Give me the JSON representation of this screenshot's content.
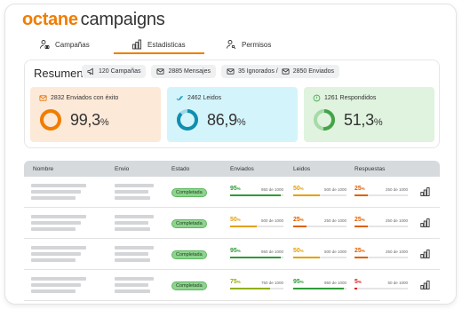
{
  "brand": {
    "part1": "octane",
    "part2": "campaigns"
  },
  "tabs": [
    {
      "label": "Campañas"
    },
    {
      "label": "Estadisticas"
    },
    {
      "label": "Permisos"
    }
  ],
  "summary": {
    "title": "Resumen",
    "chips": [
      {
        "label": "120 Campañas",
        "icon": "megaphone-icon"
      },
      {
        "label": "2885 Mensajes",
        "icon": "envelope-icon"
      },
      {
        "label": "35 Ignorados / ",
        "label2": "2850 Enviados",
        "icon": "envelope-icon"
      }
    ],
    "cards": [
      {
        "label": "2832 Enviados con éxito",
        "value": "99,3",
        "unit": "%",
        "fraction": 0.993,
        "color": "#f07d00",
        "track": "#f8c89a",
        "icon": "envelope-icon"
      },
      {
        "label": "2462 Leidos",
        "value": "86,9",
        "unit": "%",
        "fraction": 0.869,
        "color": "#0e8fb0",
        "track": "#9fd9e8",
        "icon": "double-check-icon"
      },
      {
        "label": "1261 Respondidos",
        "value": "51,3",
        "unit": "%",
        "fraction": 0.513,
        "color": "#44a447",
        "track": "#a8d9a9",
        "icon": "info-circle-icon"
      }
    ]
  },
  "table": {
    "headers": {
      "nombre": "Nombre",
      "envio": "Envio",
      "estado": "Estado",
      "enviados": "Enviados",
      "leidos": "Leidos",
      "respuestas": "Respuestas"
    },
    "rows": [
      {
        "estado": "Completada",
        "enviados": {
          "pct": "95",
          "count": "950 de 1000",
          "fraction": 0.95,
          "color": "#2e9b36"
        },
        "leidos": {
          "pct": "50",
          "count": "500 de 1000",
          "fraction": 0.5,
          "color": "#e3a100"
        },
        "respuestas": {
          "pct": "25",
          "count": "250 de 1000",
          "fraction": 0.25,
          "color": "#e06000"
        }
      },
      {
        "estado": "Completada",
        "enviados": {
          "pct": "50",
          "count": "500 de 1000",
          "fraction": 0.5,
          "color": "#e3a100"
        },
        "leidos": {
          "pct": "25",
          "count": "250 de 1000",
          "fraction": 0.25,
          "color": "#e06000"
        },
        "respuestas": {
          "pct": "25",
          "count": "250 de 1000",
          "fraction": 0.25,
          "color": "#e06000"
        }
      },
      {
        "estado": "Completada",
        "enviados": {
          "pct": "95",
          "count": "950 de 1000",
          "fraction": 0.95,
          "color": "#2e9b36"
        },
        "leidos": {
          "pct": "50",
          "count": "500 de 1000",
          "fraction": 0.5,
          "color": "#e3a100"
        },
        "respuestas": {
          "pct": "25",
          "count": "250 de 1000",
          "fraction": 0.25,
          "color": "#e06000"
        }
      },
      {
        "estado": "Completada",
        "enviados": {
          "pct": "75",
          "count": "750 de 1000",
          "fraction": 0.75,
          "color": "#8fb000"
        },
        "leidos": {
          "pct": "95",
          "count": "950 de 1000",
          "fraction": 0.95,
          "color": "#2e9b36"
        },
        "respuestas": {
          "pct": "5",
          "count": "50 de 1000",
          "fraction": 0.05,
          "color": "#d81b1b"
        }
      }
    ]
  }
}
